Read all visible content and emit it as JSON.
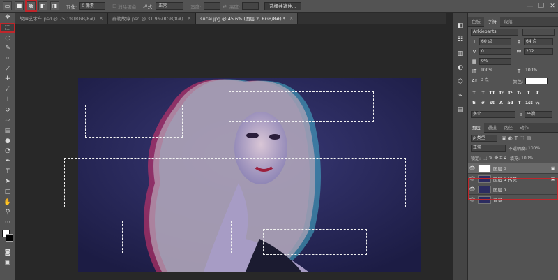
{
  "options_bar": {
    "feather_label": "羽化:",
    "feather_value": "0 像素",
    "antialias_label": "消除锯齿",
    "style_label": "样式:",
    "style_value": "正常",
    "width_label": "宽度:",
    "height_label": "高度:",
    "select_mask_button": "选择并遮住..."
  },
  "tabs": [
    {
      "label": "故障艺术车.psd @ 75.1%(RGB/8#)",
      "close": "×"
    },
    {
      "label": "泰勒故障.psd @ 31.9%(RGB/8#)",
      "close": "×"
    },
    {
      "label": "sucai.jpg @ 45.6% (图层 2, RGB/8#) *",
      "close": "×"
    }
  ],
  "character_panel": {
    "tabs": [
      "色板",
      "字符",
      "段落"
    ],
    "font_family": "Ankiepants",
    "font_size": "60 点",
    "leading": "64 点",
    "kerning": "0",
    "tracking": "202",
    "vertical_shift": "0%",
    "vertical_scale": "100%",
    "horizontal_scale": "100%",
    "baseline_shift": "0 点",
    "color_label": "颜色:",
    "style_buttons": [
      "T",
      "T",
      "TT",
      "Tr",
      "T¹",
      "T₁",
      "T",
      "Ŧ"
    ],
    "opentype_buttons": [
      "fi",
      "σ",
      "st",
      "A",
      "ad",
      "T",
      "1st",
      "½"
    ],
    "language": "多个",
    "antialias": "a",
    "antialias_mode": "平滑"
  },
  "layers_panel": {
    "tabs": [
      "图层",
      "通道",
      "路径",
      "动作"
    ],
    "filter_kind": "ρ 类型",
    "blend_mode": "正常",
    "opacity_label": "不透明度:",
    "opacity_value": "100%",
    "lock_label": "锁定:",
    "fill_label": "填充:",
    "fill_value": "100%",
    "layers": [
      {
        "name": "图层 2",
        "visible": true,
        "selected": true
      },
      {
        "name": "图层 1 拷贝",
        "visible": true,
        "selected": false
      },
      {
        "name": "图层 1",
        "visible": true,
        "selected": false
      },
      {
        "name": "背景",
        "visible": true,
        "selected": false
      }
    ]
  },
  "colors": {
    "accent_highlight": "#c0262b",
    "panel_bg": "#535353",
    "canvas_bg": "#282828"
  }
}
